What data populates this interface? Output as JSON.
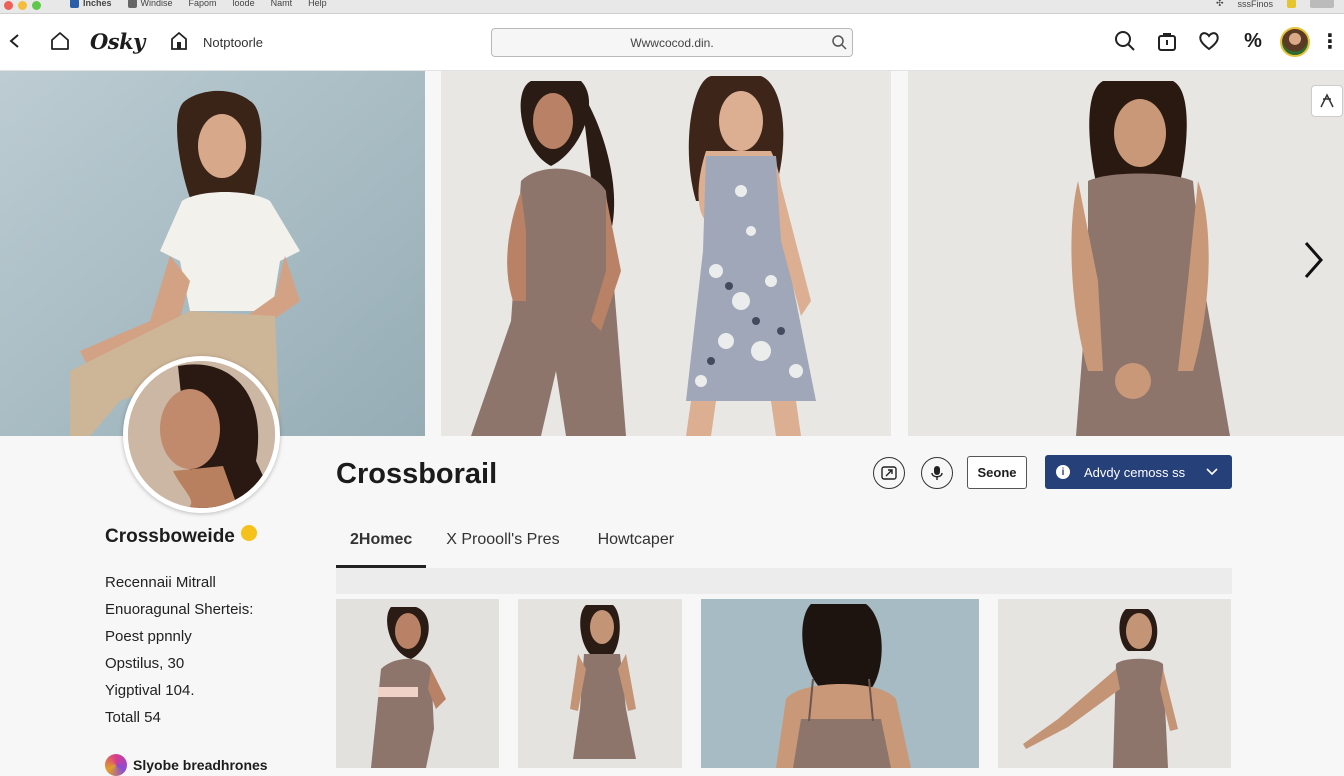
{
  "os_bar": {
    "menus": [
      "Inches",
      "Windise",
      "Fapom",
      "loode",
      "Namt",
      "Help"
    ],
    "right_text": "sssFinos"
  },
  "app": {
    "logo": "Osky",
    "page_link": "Notptoorle",
    "url": "Wwwcocod.din.",
    "icons": [
      "back-icon",
      "home-icon",
      "notifications-icon",
      "search-icon",
      "bag-icon",
      "heart-icon",
      "percent-icon",
      "more-icon"
    ]
  },
  "profile": {
    "title": "Crossborail",
    "username": "Crossboweide",
    "stats": [
      "Recennaii Mitrall",
      "Enuoragunal Sherteis:",
      "Poest ppnnly",
      "Opstilus, 30",
      "Yigptival 104.",
      "Totall 54"
    ],
    "badge_label": "Slyobe breadhrones"
  },
  "actions": {
    "share_label": "Seone",
    "primary_label": "Advdy cemoss ss",
    "primary_info": "i"
  },
  "tabs": [
    "2Homec",
    "X Proooll's Pres",
    "Howtcaper"
  ],
  "colors": {
    "primary": "#26407a",
    "dress": "#8e756c",
    "hero_bg_blue": "#a8bcc4",
    "hero_bg_gray": "#e7e6e3"
  }
}
